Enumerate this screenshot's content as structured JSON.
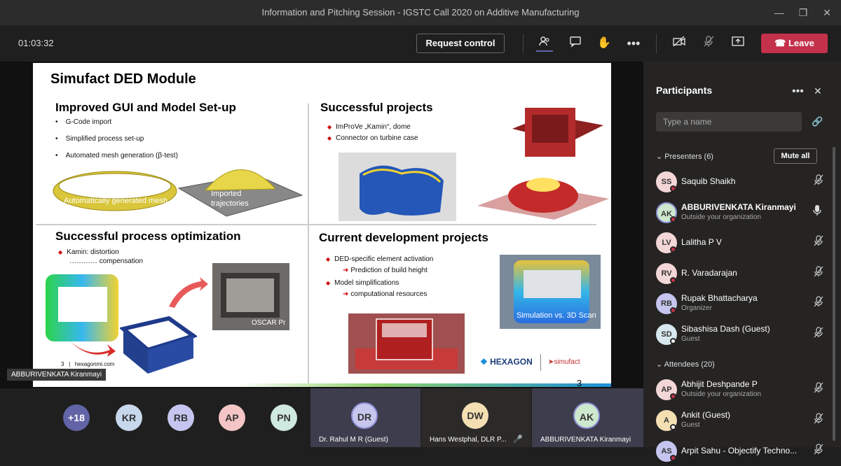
{
  "window": {
    "title": "Information and Pitching Session - IGSTC Call 2020 on Additive Manufacturing"
  },
  "toolbar": {
    "timer": "01:03:32",
    "request_control": "Request control",
    "leave": "Leave"
  },
  "slide": {
    "title": "Simufact DED Module",
    "q1": {
      "heading": "Improved GUI and Model Set-up",
      "items": [
        "G-Code import",
        "Simplified process set-up",
        "Automated mesh generation (β-test)"
      ],
      "img1_caption": "Automatically generated mesh",
      "img2_caption_1": "Imported",
      "img2_caption_2": "trajectories"
    },
    "q2": {
      "heading": "Successful projects",
      "items": [
        "ImProVe „Kamin“, dome",
        "Connector on turbine case"
      ]
    },
    "q3": {
      "heading": "Successful process optimization",
      "item": "Kamin: distortion",
      "item2": "………… compensation",
      "photo_caption": "OSCAR Pr",
      "footer_num": "3",
      "footer_site": "hexagonmi.com"
    },
    "q4": {
      "heading": "Current development projects",
      "item1": "DED-specific element activation",
      "sub1": "Prediction of build height",
      "item2": "Model simplifications",
      "sub2": "computational resources",
      "scan_caption": "Simulation vs. 3D Scan",
      "logo1": "HEXAGON",
      "logo2": "simufact"
    },
    "page_num": "3"
  },
  "stage": {
    "presenter_name": "ABBURIVENKATA Kiranmayi"
  },
  "bottom": {
    "avatars": [
      {
        "initials": "+18",
        "color": "#6264a7"
      },
      {
        "initials": "KR",
        "color": "#c7d7ec"
      },
      {
        "initials": "RB",
        "color": "#c5c5ef"
      },
      {
        "initials": "AP",
        "color": "#f5c5c5"
      },
      {
        "initials": "PN",
        "color": "#cfe8e0"
      }
    ],
    "tiles": [
      {
        "initials": "DR",
        "name": "Dr. Rahul M R (Guest)",
        "color": "#c7c7ee"
      },
      {
        "initials": "DW",
        "name": "Hans Westphal, DLR P...",
        "color": "#f3dfb2"
      },
      {
        "initials": "AK",
        "name": "ABBURIVENKATA Kiranmayi",
        "color": "#cde8cd"
      }
    ]
  },
  "panel": {
    "title": "Participants",
    "search_placeholder": "Type a name",
    "presenters_label": "Presenters (6)",
    "mute_all": "Mute all",
    "presenters": [
      {
        "initials": "SS",
        "name": "Saquib Shaikh",
        "sub": "",
        "color": "#f3d6d6",
        "status": "#c4314b"
      },
      {
        "initials": "AK",
        "name": "ABBURIVENKATA Kiranmayi",
        "sub": "Outside your organization",
        "color": "#cde8cd",
        "status": "#c4314b"
      },
      {
        "initials": "LV",
        "name": "Lalitha P V",
        "sub": "",
        "color": "#f3d6d6",
        "status": "#c4314b"
      },
      {
        "initials": "RV",
        "name": "R. Varadarajan",
        "sub": "",
        "color": "#f3d6d6",
        "status": "#c4314b"
      },
      {
        "initials": "RB",
        "name": "Rupak Bhattacharya",
        "sub": "Organizer",
        "color": "#c5c5ef",
        "status": "#c4314b"
      },
      {
        "initials": "SD",
        "name": "Sibashisa Dash (Guest)",
        "sub": "Guest",
        "color": "#d7e7ee",
        "status": "#fff"
      }
    ],
    "attendees_label": "Attendees (20)",
    "attendees": [
      {
        "initials": "AP",
        "name": "Abhijit Deshpande P",
        "sub": "Outside your organization",
        "color": "#f3d6d6",
        "status": "#c4314b"
      },
      {
        "initials": "A",
        "name": "Ankit (Guest)",
        "sub": "Guest",
        "color": "#f3dfb2",
        "status": "#fff"
      },
      {
        "initials": "AS",
        "name": "Arpit Sahu - Objectify Techno...",
        "sub": "",
        "color": "#c5c5ef",
        "status": "#c4314b"
      }
    ]
  }
}
